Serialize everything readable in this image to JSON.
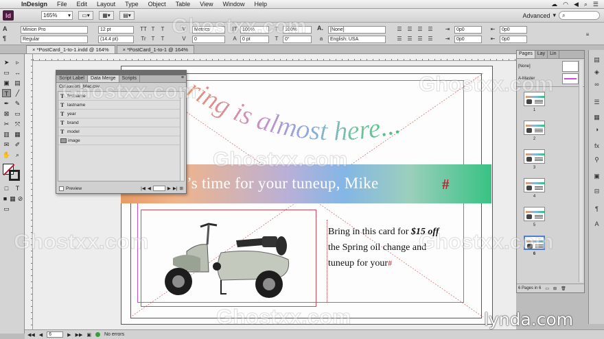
{
  "menubar": {
    "app_name": "InDesign",
    "items": [
      "File",
      "Edit",
      "Layout",
      "Type",
      "Object",
      "Table",
      "View",
      "Window",
      "Help"
    ]
  },
  "appbar": {
    "logo": "Id",
    "zoom": "165%",
    "workspace": "Advanced"
  },
  "control": {
    "font": "Minion Pro",
    "style": "Regular",
    "size": "12 pt",
    "leading": "(14.4 pt)",
    "kerning": "Metrics",
    "tracking": "0",
    "vscale": "100%",
    "hscale": "100%",
    "baseline": "0 pt",
    "skew": "0°",
    "char_style": "[None]",
    "language": "English: USA",
    "indent_values": [
      "0p0",
      "0p0",
      "0p0",
      "0p0"
    ]
  },
  "doc_tabs": [
    "*PostCard_1-to-1.indd @ 164%",
    "*PostCard_1-to-1 @ 164%"
  ],
  "data_merge": {
    "tabs": [
      "Script Label",
      "Data Merge",
      "Scripts"
    ],
    "source": "Customers_Mac.csv",
    "fields": [
      {
        "icon": "T",
        "name": "firstname"
      },
      {
        "icon": "T",
        "name": "lastname"
      },
      {
        "icon": "T",
        "name": "year"
      },
      {
        "icon": "T",
        "name": "brand"
      },
      {
        "icon": "T",
        "name": "model"
      },
      {
        "icon": "img",
        "name": "image"
      }
    ],
    "preview_label": "Preview"
  },
  "postcard": {
    "headline": "ring is almost here...",
    "band_text": "’s time for your tuneup, Mike",
    "band_hash": "#",
    "body_line1_pre": "Bring in this card for ",
    "body_line1_bold": "$15 off",
    "body_line2": "the Spring oil change and",
    "body_line3": "tuneup for your",
    "body_hash": "#"
  },
  "pages_panel": {
    "tabs": [
      "Pages",
      "Lay",
      "Lin"
    ],
    "none_label": "[None]",
    "master_label": "A-Master",
    "pages": [
      "1",
      "2",
      "3",
      "4",
      "5",
      "6"
    ],
    "footer": "6 Pages in 6"
  },
  "status": {
    "page": "6",
    "errors": "No errors"
  },
  "watermark": "Ghostxx.com",
  "brand": "lynda.com",
  "colors": {
    "accent_red": "#c9182b",
    "band_green": "#38c283",
    "band_orange": "#e79a64"
  }
}
